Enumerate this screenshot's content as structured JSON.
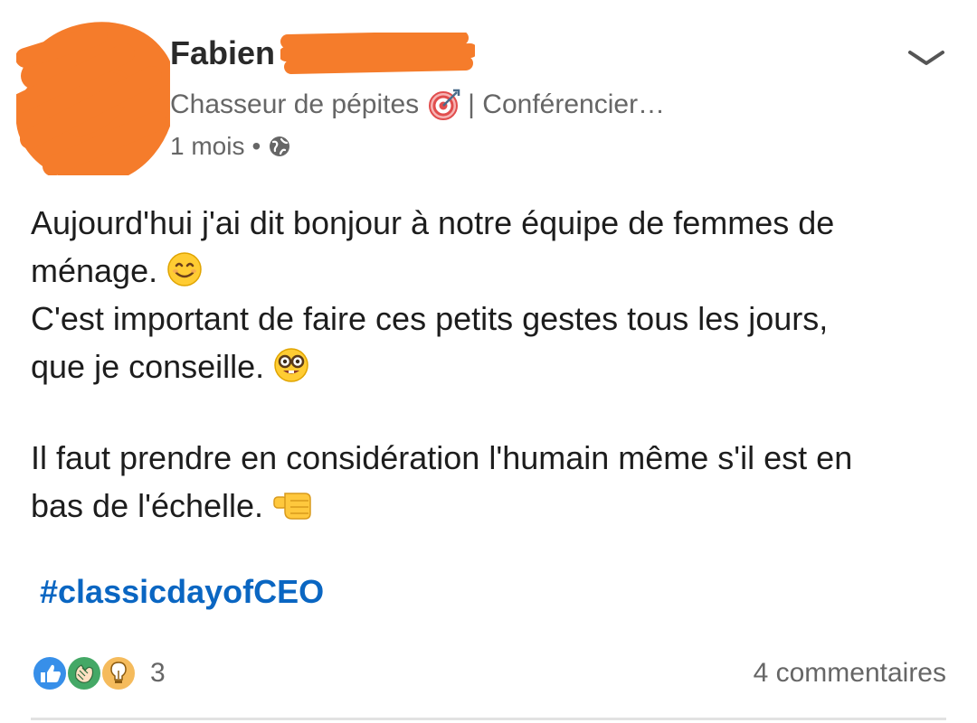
{
  "post": {
    "author": {
      "name": "Fabien",
      "headline_before_icon": "Chasseur de pépites",
      "headline_icon": "target-icon",
      "headline_after_icon": "| Conférencier…",
      "time_ago": "1 mois",
      "separator": "•",
      "visibility_icon": "globe-icon"
    },
    "menu_icon": "chevron-down-icon",
    "text": {
      "line1": "Aujourd'hui j'ai dit bonjour à notre équipe de femmes de",
      "line2": "ménage.",
      "line2_emoji": "smiling-face-emoji",
      "line3": "C'est important de faire ces petits gestes tous les jours,",
      "line4": "que je conseille.",
      "line4_emoji": "nerd-face-emoji",
      "line5": "Il faut prendre en considération l'humain même s'il est en",
      "line6": "bas de l'échelle.",
      "line6_emoji": "fist-bump-emoji"
    },
    "hashtag": "#classicdayofCEO",
    "reactions": {
      "icons": [
        "like-icon",
        "celebrate-icon",
        "insightful-icon"
      ],
      "count": "3"
    },
    "comments_label": "4 commentaires",
    "colors": {
      "accent": "#0a66c2",
      "redaction": "#f57c2b",
      "muted_text": "#666666"
    }
  }
}
